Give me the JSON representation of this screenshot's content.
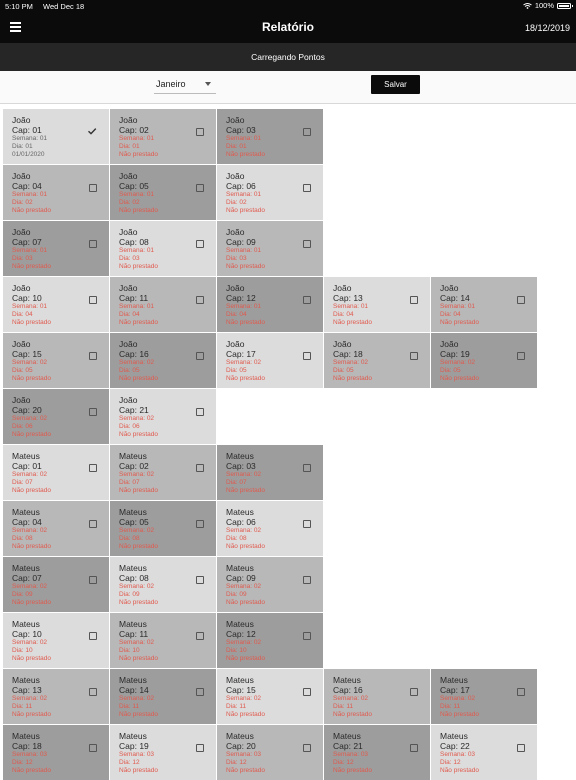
{
  "status_bar": {
    "time": "5:10 PM",
    "date": "Wed Dec 18",
    "battery": "100%"
  },
  "header": {
    "title": "Relatório",
    "date": "18/12/2019",
    "menu_icon": "menu-icon"
  },
  "banner": {
    "text": "Carregando Pontos"
  },
  "controls": {
    "month": "Janeiro",
    "save_label": "Salvar"
  },
  "colors": {
    "light": "#dcdcdc",
    "mid": "#b8b8b8",
    "dark": "#9d9d9d",
    "status_red": "#e05a4e",
    "appbar": "#0b0b0b"
  },
  "rows": [
    [
      {
        "name": "João",
        "cap": "Cap: 01",
        "semana": "Semana: 01",
        "dia": "Dia: 01",
        "status": "01/01/2020",
        "checked": true,
        "shade": "light"
      },
      {
        "name": "João",
        "cap": "Cap: 02",
        "semana": "Semana: 01",
        "dia": "Dia: 01",
        "status": "Não prestado",
        "checked": false,
        "shade": "mid"
      },
      {
        "name": "João",
        "cap": "Cap: 03",
        "semana": "Semana: 01",
        "dia": "Dia: 01",
        "status": "Não prestado",
        "checked": false,
        "shade": "dark"
      }
    ],
    [
      {
        "name": "João",
        "cap": "Cap: 04",
        "semana": "Semana: 01",
        "dia": "Dia: 02",
        "status": "Não prestado",
        "checked": false,
        "shade": "mid"
      },
      {
        "name": "João",
        "cap": "Cap: 05",
        "semana": "Semana: 01",
        "dia": "Dia: 02",
        "status": "Não prestado",
        "checked": false,
        "shade": "dark"
      },
      {
        "name": "João",
        "cap": "Cap: 06",
        "semana": "Semana: 01",
        "dia": "Dia: 02",
        "status": "Não prestado",
        "checked": false,
        "shade": "light"
      }
    ],
    [
      {
        "name": "João",
        "cap": "Cap: 07",
        "semana": "Semana: 01",
        "dia": "Dia: 03",
        "status": "Não prestado",
        "checked": false,
        "shade": "dark"
      },
      {
        "name": "João",
        "cap": "Cap: 08",
        "semana": "Semana: 01",
        "dia": "Dia: 03",
        "status": "Não prestado",
        "checked": false,
        "shade": "light"
      },
      {
        "name": "João",
        "cap": "Cap: 09",
        "semana": "Semana: 01",
        "dia": "Dia: 03",
        "status": "Não prestado",
        "checked": false,
        "shade": "mid"
      }
    ],
    [
      {
        "name": "João",
        "cap": "Cap: 10",
        "semana": "Semana: 01",
        "dia": "Dia: 04",
        "status": "Não prestado",
        "checked": false,
        "shade": "light"
      },
      {
        "name": "João",
        "cap": "Cap: 11",
        "semana": "Semana: 01",
        "dia": "Dia: 04",
        "status": "Não prestado",
        "checked": false,
        "shade": "mid"
      },
      {
        "name": "João",
        "cap": "Cap: 12",
        "semana": "Semana: 01",
        "dia": "Dia: 04",
        "status": "Não prestado",
        "checked": false,
        "shade": "dark"
      },
      {
        "name": "João",
        "cap": "Cap: 13",
        "semana": "Semana: 01",
        "dia": "Dia: 04",
        "status": "Não prestado",
        "checked": false,
        "shade": "light"
      },
      {
        "name": "João",
        "cap": "Cap: 14",
        "semana": "Semana: 01",
        "dia": "Dia: 04",
        "status": "Não prestado",
        "checked": false,
        "shade": "mid"
      }
    ],
    [
      {
        "name": "João",
        "cap": "Cap: 15",
        "semana": "Semana: 02",
        "dia": "Dia: 05",
        "status": "Não prestado",
        "checked": false,
        "shade": "mid"
      },
      {
        "name": "João",
        "cap": "Cap: 16",
        "semana": "Semana: 02",
        "dia": "Dia: 05",
        "status": "Não prestado",
        "checked": false,
        "shade": "dark"
      },
      {
        "name": "João",
        "cap": "Cap: 17",
        "semana": "Semana: 02",
        "dia": "Dia: 05",
        "status": "Não prestado",
        "checked": false,
        "shade": "light"
      },
      {
        "name": "João",
        "cap": "Cap: 18",
        "semana": "Semana: 02",
        "dia": "Dia: 05",
        "status": "Não prestado",
        "checked": false,
        "shade": "mid"
      },
      {
        "name": "João",
        "cap": "Cap: 19",
        "semana": "Semana: 02",
        "dia": "Dia: 05",
        "status": "Não prestado",
        "checked": false,
        "shade": "dark"
      }
    ],
    [
      {
        "name": "João",
        "cap": "Cap: 20",
        "semana": "Semana: 02",
        "dia": "Dia: 06",
        "status": "Não prestado",
        "checked": false,
        "shade": "dark"
      },
      {
        "name": "João",
        "cap": "Cap: 21",
        "semana": "Semana: 02",
        "dia": "Dia: 06",
        "status": "Não prestado",
        "checked": false,
        "shade": "light"
      }
    ],
    [
      {
        "name": "Mateus",
        "cap": "Cap: 01",
        "semana": "Semana: 02",
        "dia": "Dia: 07",
        "status": "Não prestado",
        "checked": false,
        "shade": "light"
      },
      {
        "name": "Mateus",
        "cap": "Cap: 02",
        "semana": "Semana: 02",
        "dia": "Dia: 07",
        "status": "Não prestado",
        "checked": false,
        "shade": "mid"
      },
      {
        "name": "Mateus",
        "cap": "Cap: 03",
        "semana": "Semana: 02",
        "dia": "Dia: 07",
        "status": "Não prestado",
        "checked": false,
        "shade": "dark"
      }
    ],
    [
      {
        "name": "Mateus",
        "cap": "Cap: 04",
        "semana": "Semana: 02",
        "dia": "Dia: 08",
        "status": "Não prestado",
        "checked": false,
        "shade": "mid"
      },
      {
        "name": "Mateus",
        "cap": "Cap: 05",
        "semana": "Semana: 02",
        "dia": "Dia: 08",
        "status": "Não prestado",
        "checked": false,
        "shade": "dark"
      },
      {
        "name": "Mateus",
        "cap": "Cap: 06",
        "semana": "Semana: 02",
        "dia": "Dia: 08",
        "status": "Não prestado",
        "checked": false,
        "shade": "light"
      }
    ],
    [
      {
        "name": "Mateus",
        "cap": "Cap: 07",
        "semana": "Semana: 02",
        "dia": "Dia: 09",
        "status": "Não prestado",
        "checked": false,
        "shade": "dark"
      },
      {
        "name": "Mateus",
        "cap": "Cap: 08",
        "semana": "Semana: 02",
        "dia": "Dia: 09",
        "status": "Não prestado",
        "checked": false,
        "shade": "light"
      },
      {
        "name": "Mateus",
        "cap": "Cap: 09",
        "semana": "Semana: 02",
        "dia": "Dia: 09",
        "status": "Não prestado",
        "checked": false,
        "shade": "mid"
      }
    ],
    [
      {
        "name": "Mateus",
        "cap": "Cap: 10",
        "semana": "Semana: 02",
        "dia": "Dia: 10",
        "status": "Não prestado",
        "checked": false,
        "shade": "light"
      },
      {
        "name": "Mateus",
        "cap": "Cap: 11",
        "semana": "Semana: 02",
        "dia": "Dia: 10",
        "status": "Não prestado",
        "checked": false,
        "shade": "mid"
      },
      {
        "name": "Mateus",
        "cap": "Cap: 12",
        "semana": "Semana: 02",
        "dia": "Dia: 10",
        "status": "Não prestado",
        "checked": false,
        "shade": "dark"
      }
    ],
    [
      {
        "name": "Mateus",
        "cap": "Cap: 13",
        "semana": "Semana: 02",
        "dia": "Dia: 11",
        "status": "Não prestado",
        "checked": false,
        "shade": "mid"
      },
      {
        "name": "Mateus",
        "cap": "Cap: 14",
        "semana": "Semana: 02",
        "dia": "Dia: 11",
        "status": "Não prestado",
        "checked": false,
        "shade": "dark"
      },
      {
        "name": "Mateus",
        "cap": "Cap: 15",
        "semana": "Semana: 02",
        "dia": "Dia: 11",
        "status": "Não prestado",
        "checked": false,
        "shade": "light"
      },
      {
        "name": "Mateus",
        "cap": "Cap: 16",
        "semana": "Semana: 02",
        "dia": "Dia: 11",
        "status": "Não prestado",
        "checked": false,
        "shade": "mid"
      },
      {
        "name": "Mateus",
        "cap": "Cap: 17",
        "semana": "Semana: 02",
        "dia": "Dia: 11",
        "status": "Não prestado",
        "checked": false,
        "shade": "dark"
      }
    ],
    [
      {
        "name": "Mateus",
        "cap": "Cap: 18",
        "semana": "Semana: 03",
        "dia": "Dia: 12",
        "status": "Não prestado",
        "checked": false,
        "shade": "dark"
      },
      {
        "name": "Mateus",
        "cap": "Cap: 19",
        "semana": "Semana: 03",
        "dia": "Dia: 12",
        "status": "Não prestado",
        "checked": false,
        "shade": "light"
      },
      {
        "name": "Mateus",
        "cap": "Cap: 20",
        "semana": "Semana: 03",
        "dia": "Dia: 12",
        "status": "Não prestado",
        "checked": false,
        "shade": "mid"
      },
      {
        "name": "Mateus",
        "cap": "Cap: 21",
        "semana": "Semana: 03",
        "dia": "Dia: 12",
        "status": "Não prestado",
        "checked": false,
        "shade": "dark"
      },
      {
        "name": "Mateus",
        "cap": "Cap: 22",
        "semana": "Semana: 03",
        "dia": "Dia: 12",
        "status": "Não prestado",
        "checked": false,
        "shade": "light"
      }
    ]
  ]
}
